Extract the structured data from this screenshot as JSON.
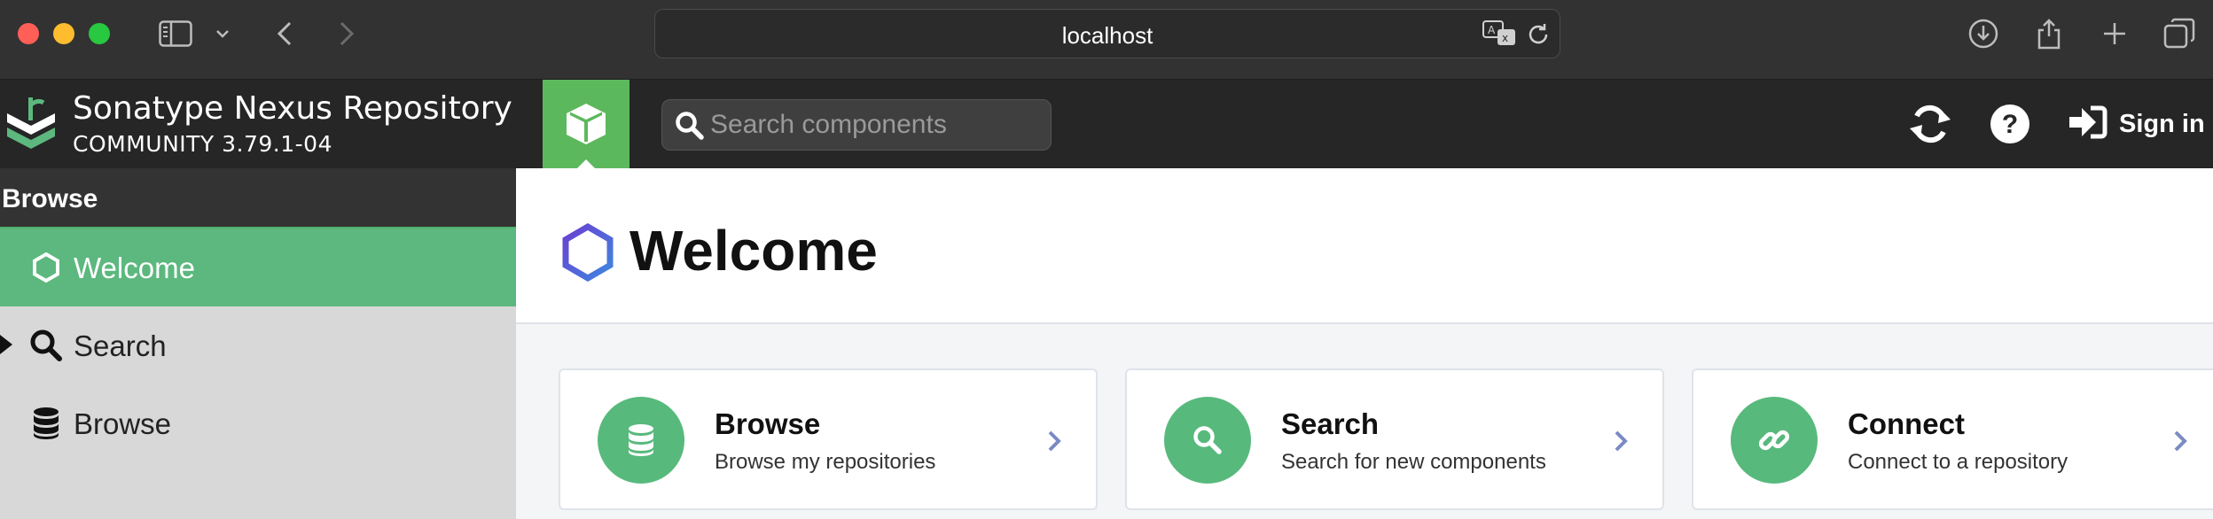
{
  "browser": {
    "url": "localhost"
  },
  "header": {
    "brand_title": "Sonatype Nexus Repository",
    "brand_subtitle": "COMMUNITY 3.79.1-04",
    "search_placeholder": "Search components",
    "sign_in_label": "Sign in"
  },
  "sidebar": {
    "title": "Browse",
    "items": [
      {
        "label": "Welcome",
        "icon": "hexagon-icon",
        "selected": true
      },
      {
        "label": "Search",
        "icon": "search-icon",
        "expandable": true
      },
      {
        "label": "Browse",
        "icon": "database-icon"
      }
    ]
  },
  "main": {
    "title": "Welcome",
    "cards": [
      {
        "title": "Browse",
        "subtitle": "Browse my repositories",
        "icon": "database-icon"
      },
      {
        "title": "Search",
        "subtitle": "Search for new components",
        "icon": "search-icon"
      },
      {
        "title": "Connect",
        "subtitle": "Connect to a repository",
        "icon": "link-icon"
      }
    ]
  },
  "colors": {
    "accent_green": "#5cb85c",
    "header_bg": "#262626",
    "card_icon_green": "#58b97d",
    "hexagon_purple": "#5b4fd6",
    "chevron_blue": "#7a8bc4"
  }
}
